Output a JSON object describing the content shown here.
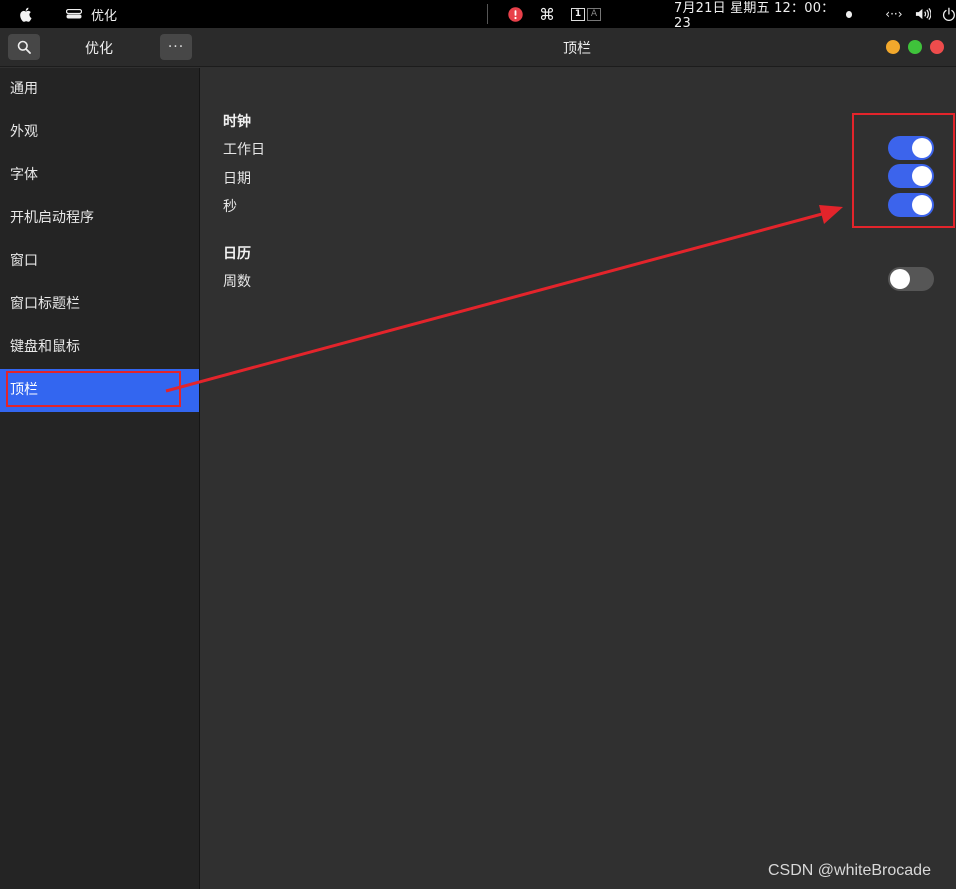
{
  "topbar": {
    "app_name": "优化",
    "datetime": "7月21日 星期五  12：00：23",
    "cmd_glyph": "⌘",
    "workspace_active": "1",
    "workspace_other": "A",
    "net_glyph": "‹··›",
    "icons": [
      "apple-icon",
      "app-switch-icon",
      "alert-icon",
      "cmd-icon",
      "workspace-indicator",
      "network-icon",
      "volume-icon",
      "power-icon"
    ]
  },
  "window": {
    "sidebar_title": "优化",
    "more_label": "···",
    "title": "顶栏"
  },
  "sidebar": {
    "items": [
      {
        "label": "通用"
      },
      {
        "label": "外观"
      },
      {
        "label": "字体"
      },
      {
        "label": "开机启动程序"
      },
      {
        "label": "窗口"
      },
      {
        "label": "窗口标题栏"
      },
      {
        "label": "键盘和鼠标"
      },
      {
        "label": "顶栏"
      }
    ],
    "active_index": 7
  },
  "content": {
    "clock": {
      "title": "时钟",
      "rows": [
        {
          "label": "工作日",
          "on": true
        },
        {
          "label": "日期",
          "on": true
        },
        {
          "label": "秒",
          "on": true
        }
      ]
    },
    "calendar": {
      "title": "日历",
      "rows": [
        {
          "label": "周数",
          "on": false
        }
      ]
    }
  },
  "colors": {
    "accent": "#3366f0",
    "toggle_on": "#3c64ec",
    "annotation": "#e3242b",
    "close": "#ee4c4c",
    "minimize": "#f2a82c",
    "maximize": "#3fc33b"
  },
  "watermark": "CSDN @whiteBrocade"
}
